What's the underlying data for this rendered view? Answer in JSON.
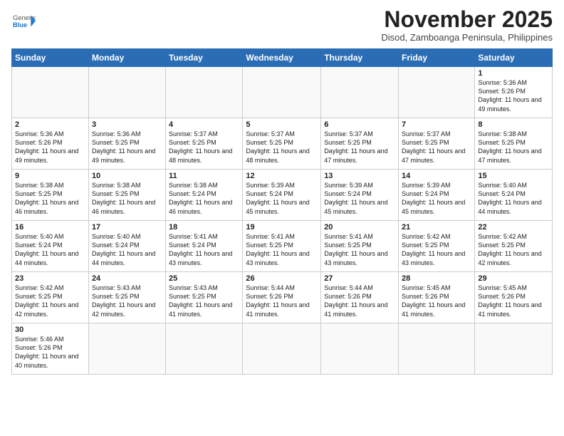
{
  "logo": {
    "text_general": "General",
    "text_blue": "Blue"
  },
  "header": {
    "month": "November 2025",
    "location": "Disod, Zamboanga Peninsula, Philippines"
  },
  "days_of_week": [
    "Sunday",
    "Monday",
    "Tuesday",
    "Wednesday",
    "Thursday",
    "Friday",
    "Saturday"
  ],
  "weeks": [
    [
      {
        "day": "",
        "info": ""
      },
      {
        "day": "",
        "info": ""
      },
      {
        "day": "",
        "info": ""
      },
      {
        "day": "",
        "info": ""
      },
      {
        "day": "",
        "info": ""
      },
      {
        "day": "",
        "info": ""
      },
      {
        "day": "1",
        "info": "Sunrise: 5:36 AM\nSunset: 5:26 PM\nDaylight: 11 hours and 49 minutes."
      }
    ],
    [
      {
        "day": "2",
        "info": "Sunrise: 5:36 AM\nSunset: 5:26 PM\nDaylight: 11 hours and 49 minutes."
      },
      {
        "day": "3",
        "info": "Sunrise: 5:36 AM\nSunset: 5:25 PM\nDaylight: 11 hours and 49 minutes."
      },
      {
        "day": "4",
        "info": "Sunrise: 5:37 AM\nSunset: 5:25 PM\nDaylight: 11 hours and 48 minutes."
      },
      {
        "day": "5",
        "info": "Sunrise: 5:37 AM\nSunset: 5:25 PM\nDaylight: 11 hours and 48 minutes."
      },
      {
        "day": "6",
        "info": "Sunrise: 5:37 AM\nSunset: 5:25 PM\nDaylight: 11 hours and 47 minutes."
      },
      {
        "day": "7",
        "info": "Sunrise: 5:37 AM\nSunset: 5:25 PM\nDaylight: 11 hours and 47 minutes."
      },
      {
        "day": "8",
        "info": "Sunrise: 5:38 AM\nSunset: 5:25 PM\nDaylight: 11 hours and 47 minutes."
      }
    ],
    [
      {
        "day": "9",
        "info": "Sunrise: 5:38 AM\nSunset: 5:25 PM\nDaylight: 11 hours and 46 minutes."
      },
      {
        "day": "10",
        "info": "Sunrise: 5:38 AM\nSunset: 5:25 PM\nDaylight: 11 hours and 46 minutes."
      },
      {
        "day": "11",
        "info": "Sunrise: 5:38 AM\nSunset: 5:24 PM\nDaylight: 11 hours and 46 minutes."
      },
      {
        "day": "12",
        "info": "Sunrise: 5:39 AM\nSunset: 5:24 PM\nDaylight: 11 hours and 45 minutes."
      },
      {
        "day": "13",
        "info": "Sunrise: 5:39 AM\nSunset: 5:24 PM\nDaylight: 11 hours and 45 minutes."
      },
      {
        "day": "14",
        "info": "Sunrise: 5:39 AM\nSunset: 5:24 PM\nDaylight: 11 hours and 45 minutes."
      },
      {
        "day": "15",
        "info": "Sunrise: 5:40 AM\nSunset: 5:24 PM\nDaylight: 11 hours and 44 minutes."
      }
    ],
    [
      {
        "day": "16",
        "info": "Sunrise: 5:40 AM\nSunset: 5:24 PM\nDaylight: 11 hours and 44 minutes."
      },
      {
        "day": "17",
        "info": "Sunrise: 5:40 AM\nSunset: 5:24 PM\nDaylight: 11 hours and 44 minutes."
      },
      {
        "day": "18",
        "info": "Sunrise: 5:41 AM\nSunset: 5:24 PM\nDaylight: 11 hours and 43 minutes."
      },
      {
        "day": "19",
        "info": "Sunrise: 5:41 AM\nSunset: 5:25 PM\nDaylight: 11 hours and 43 minutes."
      },
      {
        "day": "20",
        "info": "Sunrise: 5:41 AM\nSunset: 5:25 PM\nDaylight: 11 hours and 43 minutes."
      },
      {
        "day": "21",
        "info": "Sunrise: 5:42 AM\nSunset: 5:25 PM\nDaylight: 11 hours and 43 minutes."
      },
      {
        "day": "22",
        "info": "Sunrise: 5:42 AM\nSunset: 5:25 PM\nDaylight: 11 hours and 42 minutes."
      }
    ],
    [
      {
        "day": "23",
        "info": "Sunrise: 5:42 AM\nSunset: 5:25 PM\nDaylight: 11 hours and 42 minutes."
      },
      {
        "day": "24",
        "info": "Sunrise: 5:43 AM\nSunset: 5:25 PM\nDaylight: 11 hours and 42 minutes."
      },
      {
        "day": "25",
        "info": "Sunrise: 5:43 AM\nSunset: 5:25 PM\nDaylight: 11 hours and 41 minutes."
      },
      {
        "day": "26",
        "info": "Sunrise: 5:44 AM\nSunset: 5:26 PM\nDaylight: 11 hours and 41 minutes."
      },
      {
        "day": "27",
        "info": "Sunrise: 5:44 AM\nSunset: 5:26 PM\nDaylight: 11 hours and 41 minutes."
      },
      {
        "day": "28",
        "info": "Sunrise: 5:45 AM\nSunset: 5:26 PM\nDaylight: 11 hours and 41 minutes."
      },
      {
        "day": "29",
        "info": "Sunrise: 5:45 AM\nSunset: 5:26 PM\nDaylight: 11 hours and 41 minutes."
      }
    ],
    [
      {
        "day": "30",
        "info": "Sunrise: 5:46 AM\nSunset: 5:26 PM\nDaylight: 11 hours and 40 minutes."
      },
      {
        "day": "",
        "info": ""
      },
      {
        "day": "",
        "info": ""
      },
      {
        "day": "",
        "info": ""
      },
      {
        "day": "",
        "info": ""
      },
      {
        "day": "",
        "info": ""
      },
      {
        "day": "",
        "info": ""
      }
    ]
  ]
}
